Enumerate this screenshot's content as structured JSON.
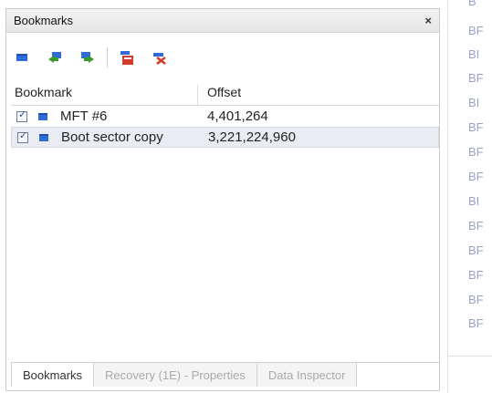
{
  "bookmarks_panel": {
    "title": "Bookmarks",
    "close_glyph": "×",
    "toolbar": [
      {
        "icon": "bookmark-icon",
        "color": "#2f6bd6"
      },
      {
        "icon": "arrow-import-icon",
        "color": "#3a9a2a"
      },
      {
        "icon": "arrow-export-icon",
        "color": "#3a9a2a"
      },
      {
        "icon": "delete-bookmark-icon",
        "color": "#d23a2a"
      },
      {
        "icon": "clear-all-icon",
        "color": "#d23a2a"
      }
    ],
    "columns": {
      "bookmark": "Bookmark",
      "offset": "Offset"
    },
    "rows": [
      {
        "checked": true,
        "name": "MFT #6",
        "offset": "4,401,264"
      },
      {
        "checked": true,
        "name": "Boot sector copy",
        "offset": "3,221,224,960"
      }
    ],
    "tabs": [
      {
        "label": "Bookmarks",
        "active": true
      },
      {
        "label": "Recovery (1E) - Properties",
        "active": false
      },
      {
        "label": "Data Inspector",
        "active": false
      }
    ]
  },
  "right_pane": {
    "items": [
      "B",
      "BF",
      "BI",
      "BF",
      "BI",
      "BF",
      "BF",
      "BF",
      "BI",
      "BF",
      "BF",
      "BF",
      "BF",
      "BF",
      "BF"
    ]
  }
}
